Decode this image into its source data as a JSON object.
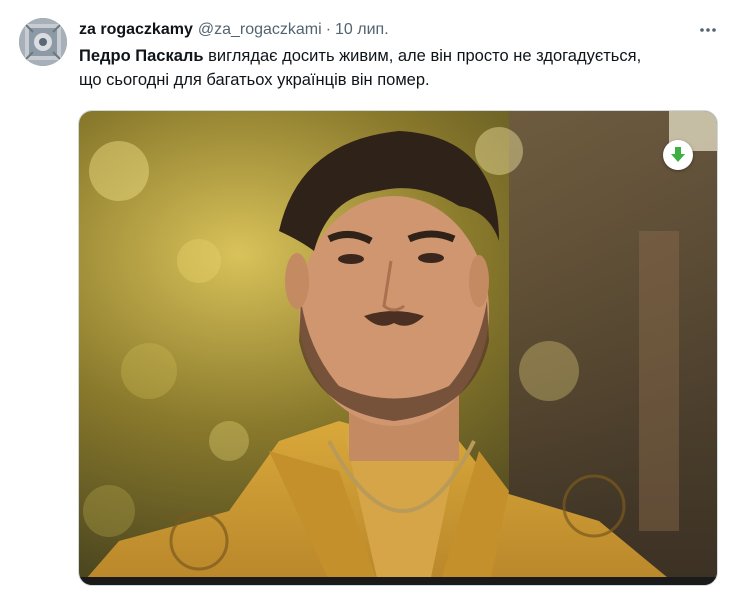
{
  "tweet": {
    "author": {
      "display_name": "za rogaczkamy",
      "handle": "@za_rogaczkami",
      "avatar_icon": "avatar-image"
    },
    "separator": "·",
    "date": "10 лип.",
    "more_icon": "more-dots-icon",
    "text": {
      "bold_part": "Педро Паскаль",
      "line1_rest": " виглядає досить живим, але він просто не здогадується,",
      "line2": "що сьогодні для багатьох українців він помер."
    },
    "media": {
      "alt": "photo",
      "download_icon": "download-arrow-icon",
      "download_color": "#3cb043"
    }
  }
}
